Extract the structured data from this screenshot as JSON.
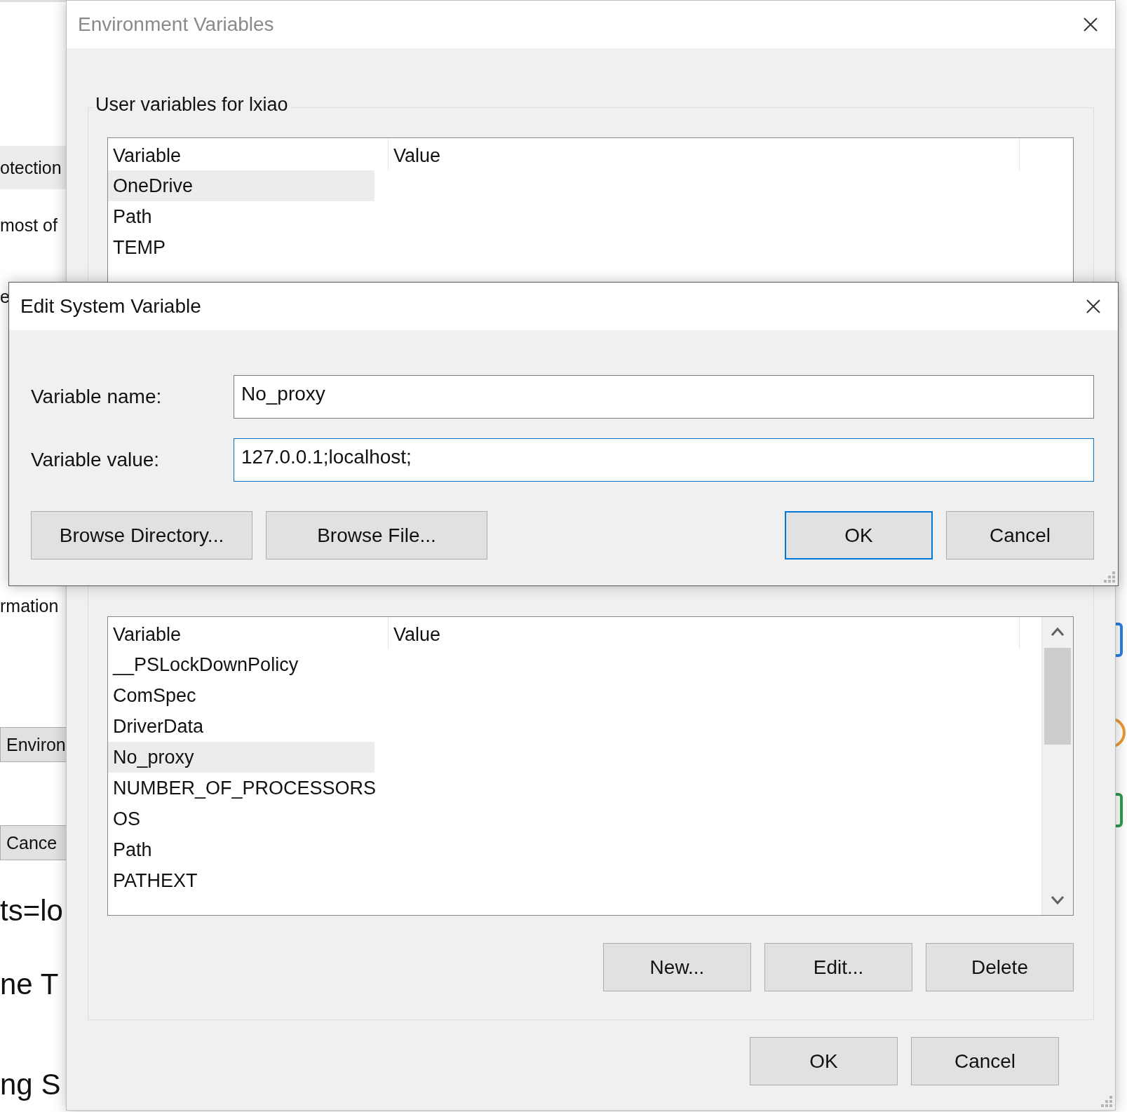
{
  "background": {
    "items": [
      {
        "kind": "band",
        "text": "otection"
      },
      {
        "kind": "text",
        "text": "most of"
      },
      {
        "kind": "text",
        "text": "e"
      },
      {
        "kind": "text",
        "text": "rmation"
      },
      {
        "kind": "button",
        "text": "Environ"
      },
      {
        "kind": "button",
        "text": "Cance"
      },
      {
        "kind": "large",
        "text": "ts=lo"
      },
      {
        "kind": "large",
        "text": "ne T"
      },
      {
        "kind": "large",
        "text": "ng S"
      }
    ]
  },
  "environment_window": {
    "title": "Environment Variables",
    "user_group": {
      "label": "User variables for lxiao",
      "columns": [
        "Variable",
        "Value"
      ],
      "rows": [
        {
          "variable": "OneDrive",
          "selected": true
        },
        {
          "variable": "Path",
          "selected": false
        },
        {
          "variable": "TEMP",
          "selected": false
        }
      ]
    },
    "system_group": {
      "columns": [
        "Variable",
        "Value"
      ],
      "rows": [
        {
          "variable": "__PSLockDownPolicy",
          "selected": false
        },
        {
          "variable": "ComSpec",
          "selected": false
        },
        {
          "variable": "DriverData",
          "selected": false
        },
        {
          "variable": "No_proxy",
          "selected": true
        },
        {
          "variable": "NUMBER_OF_PROCESSORS",
          "selected": false
        },
        {
          "variable": "OS",
          "selected": false
        },
        {
          "variable": "Path",
          "selected": false
        },
        {
          "variable": "PATHEXT",
          "selected": false
        }
      ],
      "buttons": [
        "New...",
        "Edit...",
        "Delete"
      ]
    },
    "buttons": [
      "OK",
      "Cancel"
    ]
  },
  "edit_dialog": {
    "title": "Edit System Variable",
    "fields": [
      {
        "label": "Variable name:",
        "value": "No_proxy",
        "focused": false
      },
      {
        "label": "Variable value:",
        "value": "127.0.0.1;localhost;",
        "focused": true
      }
    ],
    "buttons": [
      {
        "label": "Browse Directory...",
        "default": false
      },
      {
        "label": "Browse File...",
        "default": false
      },
      {
        "label": "OK",
        "default": true
      },
      {
        "label": "Cancel",
        "default": false
      }
    ]
  }
}
